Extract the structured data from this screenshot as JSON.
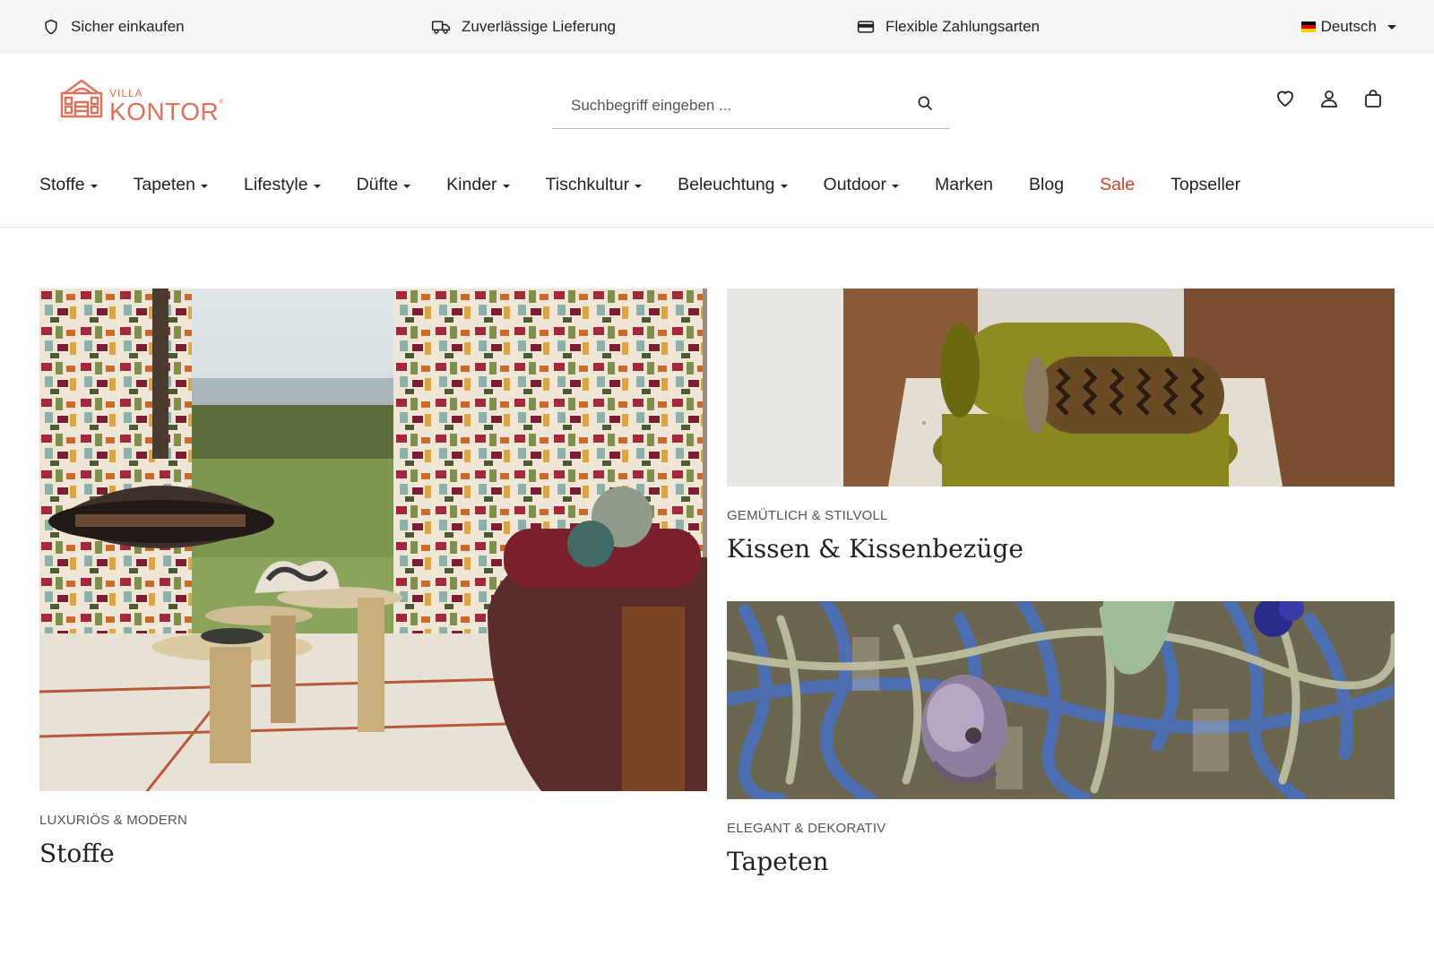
{
  "topbar": {
    "usps": [
      {
        "label": "Sicher einkaufen",
        "icon": "shield-icon"
      },
      {
        "label": "Zuverlässige Lieferung",
        "icon": "truck-icon"
      },
      {
        "label": "Flexible Zahlungsarten",
        "icon": "credit-card-icon"
      }
    ],
    "language": {
      "label": "Deutsch",
      "flag": "german-flag-icon"
    }
  },
  "header": {
    "logo": {
      "line1": "VILLA",
      "line2": "KONTOR",
      "mark": "®"
    },
    "search": {
      "placeholder": "Suchbegriff eingeben ..."
    },
    "icons": [
      "heart-icon",
      "user-icon",
      "shopping-bag-icon"
    ]
  },
  "nav": {
    "items": [
      {
        "label": "Stoffe",
        "dropdown": true
      },
      {
        "label": "Tapeten",
        "dropdown": true
      },
      {
        "label": "Lifestyle",
        "dropdown": true
      },
      {
        "label": "Düfte",
        "dropdown": true
      },
      {
        "label": "Kinder",
        "dropdown": true
      },
      {
        "label": "Tischkultur",
        "dropdown": true
      },
      {
        "label": "Beleuchtung",
        "dropdown": true
      },
      {
        "label": "Outdoor",
        "dropdown": true
      },
      {
        "label": "Marken",
        "dropdown": false
      },
      {
        "label": "Blog",
        "dropdown": false
      },
      {
        "label": "Sale",
        "dropdown": false,
        "highlight": true
      },
      {
        "label": "Topseller",
        "dropdown": false
      }
    ]
  },
  "teasers": {
    "stoffe": {
      "eyebrow": "LUXURIÖS & MODERN",
      "title": "Stoffe"
    },
    "kissen": {
      "eyebrow": "GEMÜTLICH & STILVOLL",
      "title": "Kissen & Kissenbezüge"
    },
    "tapeten": {
      "eyebrow": "ELEGANT & DEKORATIV",
      "title": "Tapeten"
    }
  },
  "colors": {
    "accent": "#c8432a",
    "logo": "#e0705a",
    "topbar_bg": "#f5f5f5"
  }
}
